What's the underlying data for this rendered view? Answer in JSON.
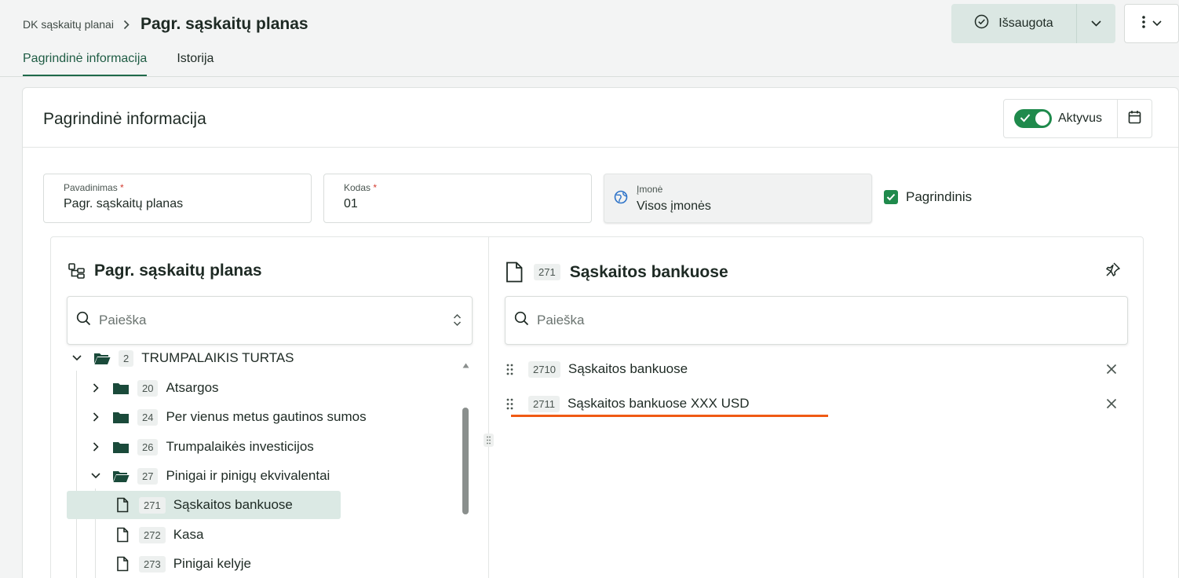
{
  "breadcrumb": {
    "parent": "DK sąskaitų planai",
    "current": "Pagr. sąskaitų planas"
  },
  "header": {
    "save_label": "Išsaugota"
  },
  "tabs": [
    {
      "label": "Pagrindinė informacija"
    },
    {
      "label": "Istorija"
    }
  ],
  "card": {
    "title": "Pagrindinė informacija",
    "active_label": "Aktyvus",
    "fields": {
      "name": {
        "label": "Pavadinimas",
        "required": "*",
        "value": "Pagr. sąskaitų planas"
      },
      "code": {
        "label": "Kodas",
        "required": "*",
        "value": "01"
      },
      "company": {
        "label": "Įmonė",
        "value": "Visos įmonės"
      }
    },
    "primary_label": "Pagrindinis"
  },
  "left_panel": {
    "title": "Pagr. sąskaitų planas",
    "search_placeholder": "Paieška",
    "tree": [
      {
        "code": "2",
        "label": "TRUMPALAIKIS TURTAS"
      },
      {
        "code": "20",
        "label": "Atsargos"
      },
      {
        "code": "24",
        "label": "Per vienus metus gautinos sumos"
      },
      {
        "code": "26",
        "label": "Trumpalaikės investicijos"
      },
      {
        "code": "27",
        "label": "Pinigai ir pinigų ekvivalentai"
      },
      {
        "code": "271",
        "label": "Sąskaitos bankuose"
      },
      {
        "code": "272",
        "label": "Kasa"
      },
      {
        "code": "273",
        "label": "Pinigai kelyje"
      }
    ]
  },
  "right_panel": {
    "code": "271",
    "title": "Sąskaitos bankuose",
    "search_placeholder": "Paieška",
    "accounts": [
      {
        "code": "2710",
        "label": "Sąskaitos bankuose"
      },
      {
        "code": "2711",
        "label": "Sąskaitos bankuose XXX USD"
      }
    ]
  },
  "colors": {
    "accent": "#1f6a4a",
    "toggle": "#1f8a4c",
    "annotation": "#f05a14"
  }
}
